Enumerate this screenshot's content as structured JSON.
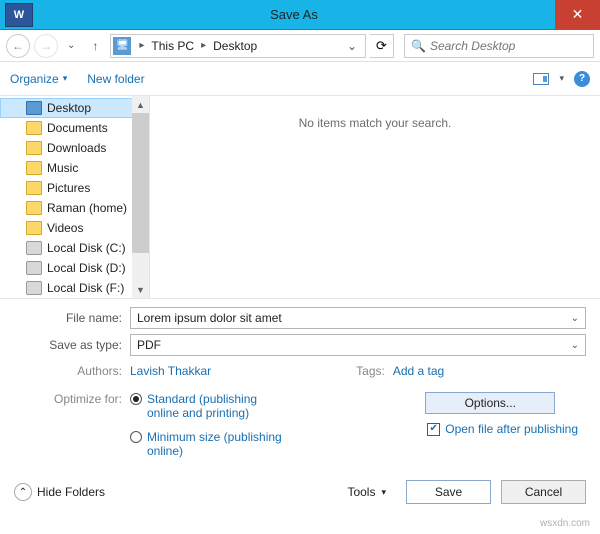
{
  "window": {
    "title": "Save As",
    "app_icon": "W"
  },
  "nav": {
    "breadcrumb": [
      "This PC",
      "Desktop"
    ],
    "search_placeholder": "Search Desktop"
  },
  "commands": {
    "organize": "Organize",
    "newfolder": "New folder"
  },
  "tree": {
    "items": [
      {
        "label": "Desktop",
        "icon": "blue",
        "selected": true
      },
      {
        "label": "Documents",
        "icon": "folder"
      },
      {
        "label": "Downloads",
        "icon": "folder"
      },
      {
        "label": "Music",
        "icon": "folder"
      },
      {
        "label": "Pictures",
        "icon": "folder"
      },
      {
        "label": "Raman (home)",
        "icon": "folder"
      },
      {
        "label": "Videos",
        "icon": "folder"
      },
      {
        "label": "Local Disk (C:)",
        "icon": "drive"
      },
      {
        "label": "Local Disk (D:)",
        "icon": "drive"
      },
      {
        "label": "Local Disk (F:)",
        "icon": "drive"
      }
    ]
  },
  "listing": {
    "empty_message": "No items match your search."
  },
  "form": {
    "filename_label": "File name:",
    "filename_value": "Lorem ipsum dolor sit amet",
    "saveas_label": "Save as type:",
    "saveas_value": "PDF",
    "authors_label": "Authors:",
    "authors_value": "Lavish Thakkar",
    "tags_label": "Tags:",
    "tags_value": "Add a tag"
  },
  "optimize": {
    "label": "Optimize for:",
    "standard": "Standard (publishing online and printing)",
    "minimum": "Minimum size (publishing online)"
  },
  "options": {
    "button": "Options...",
    "openafter": "Open file after publishing"
  },
  "footer": {
    "hidefolders": "Hide Folders",
    "tools": "Tools",
    "save": "Save",
    "cancel": "Cancel"
  },
  "watermark": "wsxdn.com"
}
